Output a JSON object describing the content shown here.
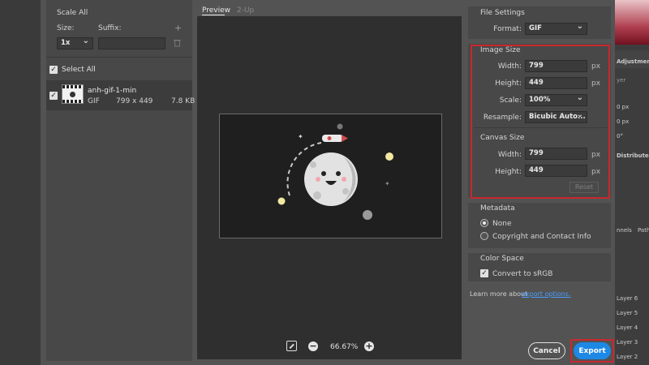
{
  "left": {
    "scale_all": "Scale All",
    "size_label": "Size:",
    "suffix_label": "Suffix:",
    "size_value": "1x",
    "add_symbol": "+",
    "select_all": "Select All",
    "file": {
      "name": "anh-gif-1-min",
      "format": "GIF",
      "dims": "799 x 449",
      "size": "7.8 KB"
    }
  },
  "preview": {
    "tabs": [
      "Preview",
      "2-Up"
    ],
    "zoom": "66.67%"
  },
  "file_settings": {
    "title": "File Settings",
    "format_label": "Format:",
    "format_value": "GIF"
  },
  "image_size": {
    "title": "Image Size",
    "width_label": "Width:",
    "width_value": "799",
    "height_label": "Height:",
    "height_value": "449",
    "scale_label": "Scale:",
    "scale_value": "100%",
    "resample_label": "Resample:",
    "resample_value": "Bicubic Auto...",
    "unit": "px"
  },
  "canvas_size": {
    "title": "Canvas Size",
    "width_label": "Width:",
    "width_value": "799",
    "height_label": "Height:",
    "height_value": "449",
    "unit": "px",
    "reset": "Reset"
  },
  "metadata": {
    "title": "Metadata",
    "options": [
      "None",
      "Copyright and Contact Info"
    ]
  },
  "color_space": {
    "title": "Color Space",
    "convert": "Convert to sRGB"
  },
  "learn_more": {
    "text": "Learn more about",
    "link": "export options."
  },
  "buttons": {
    "cancel": "Cancel",
    "export": "Export"
  },
  "bg_app": {
    "adjustments": "Adjustments",
    "layer_short": "yer",
    "px1": "0 px",
    "px2": "0 px",
    "deg": "0°",
    "distribute": "Distribute",
    "channels": "nnels",
    "paths": "Path",
    "layers": [
      "Layer 6",
      "Layer 5",
      "Layer 4",
      "Layer 3",
      "Layer 2"
    ]
  },
  "colors": {
    "accent": "#1e88e5",
    "highlight": "#c8282e"
  }
}
